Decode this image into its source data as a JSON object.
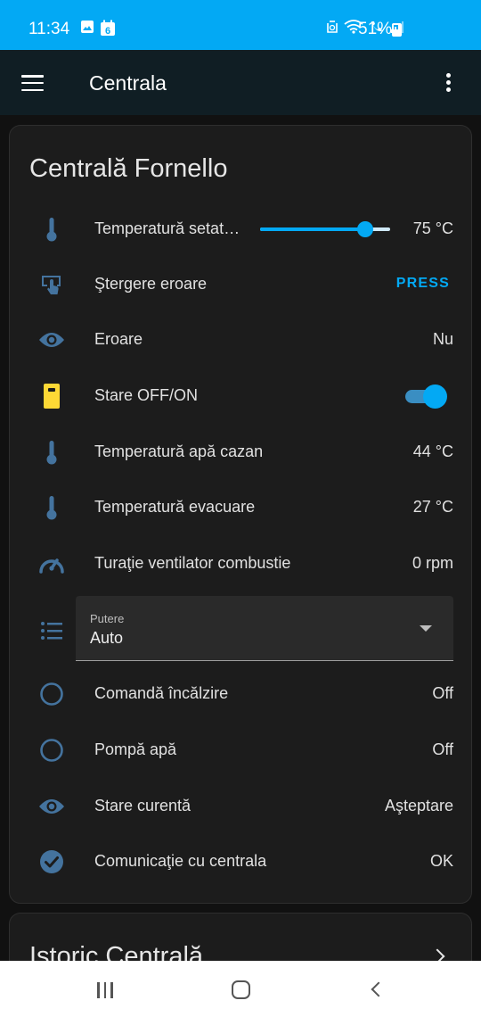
{
  "status_bar": {
    "time": "11:34",
    "calendar_day": "6",
    "battery": "51%"
  },
  "app_bar": {
    "title": "Centrala"
  },
  "card": {
    "title": "Centrală Fornello",
    "rows": [
      {
        "label": "Temperatură setat…",
        "value": "75 °C",
        "icon": "thermometer-icon",
        "slider_fraction": 0.81
      },
      {
        "label": "Ştergere eroare",
        "action": "PRESS",
        "icon": "gesture-tap-button-icon"
      },
      {
        "label": "Eroare",
        "value": "Nu",
        "icon": "eye-icon"
      },
      {
        "label": "Stare OFF/ON",
        "icon": "boiler-icon",
        "toggle_on": true
      },
      {
        "label": "Temperatură apă cazan",
        "value": "44 °C",
        "icon": "thermometer-icon"
      },
      {
        "label": "Temperatură evacuare",
        "value": "27 °C",
        "icon": "thermometer-icon"
      },
      {
        "label": "Turaţie ventilator combustie",
        "value": "0 rpm",
        "icon": "gauge-icon"
      },
      {
        "label": "Comandă încălzire",
        "value": "Off",
        "icon": "circle-outline-icon"
      },
      {
        "label": "Pompă apă",
        "value": "Off",
        "icon": "circle-outline-icon"
      },
      {
        "label": "Stare curentă",
        "value": "Aşteptare",
        "icon": "eye-icon"
      },
      {
        "label": "Comunicaţie cu centrala",
        "value": "OK",
        "icon": "check-circle-icon"
      }
    ],
    "select": {
      "label": "Putere",
      "value": "Auto",
      "icon": "format-list-bulleted-icon"
    }
  },
  "card2": {
    "title": "Istoric Centrală"
  },
  "colors": {
    "accent": "#03a9f4",
    "icon_blue": "#44739e",
    "icon_yellow": "#fdd835",
    "card_bg": "#1c1c1c"
  }
}
